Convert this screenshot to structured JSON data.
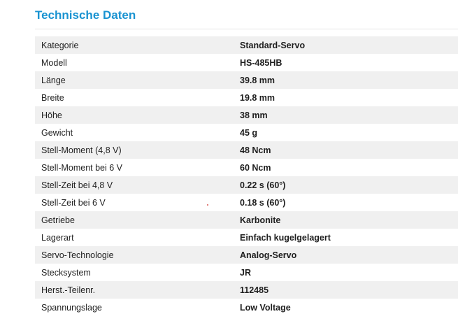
{
  "section": {
    "title": "Technische Daten"
  },
  "specs": [
    {
      "label": "Kategorie",
      "value": "Standard-Servo"
    },
    {
      "label": "Modell",
      "value": "HS-485HB"
    },
    {
      "label": "Länge",
      "value": "39.8 mm"
    },
    {
      "label": "Breite",
      "value": "19.8 mm"
    },
    {
      "label": "Höhe",
      "value": "38 mm"
    },
    {
      "label": "Gewicht",
      "value": "45 g"
    },
    {
      "label": "Stell-Moment (4,8 V)",
      "value": "48 Ncm"
    },
    {
      "label": "Stell-Moment bei 6 V",
      "value": "60 Ncm"
    },
    {
      "label": "Stell-Zeit bei 4,8 V",
      "value": "0.22 s (60°)"
    },
    {
      "label": "Stell-Zeit bei 6 V",
      "value": "0.18 s (60°)"
    },
    {
      "label": "Getriebe",
      "value": "Karbonite"
    },
    {
      "label": "Lagerart",
      "value": "Einfach kugelgelagert"
    },
    {
      "label": "Servo-Technologie",
      "value": "Analog-Servo"
    },
    {
      "label": "Stecksystem",
      "value": "JR"
    },
    {
      "label": "Herst.-Teilenr.",
      "value": "112485"
    },
    {
      "label": "Spannungslage",
      "value": "Low Voltage"
    }
  ],
  "colors": {
    "title": "#1a93d1",
    "row_shaded": "#f0f0f0",
    "row_plain": "#ffffff"
  }
}
